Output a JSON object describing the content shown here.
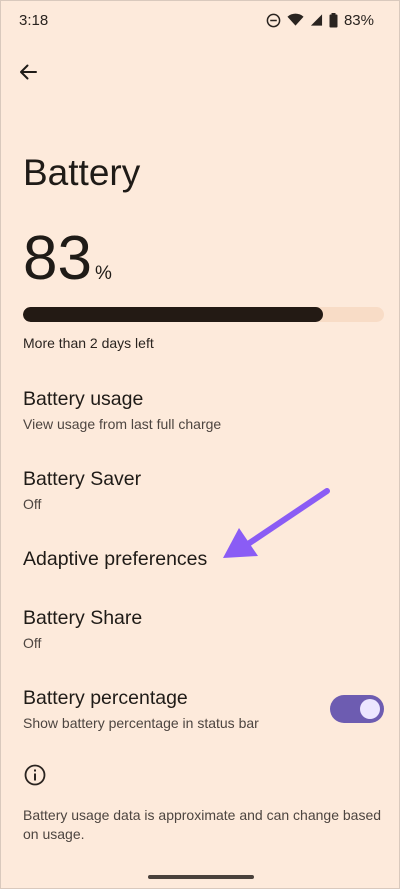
{
  "status_bar": {
    "time": "3:18",
    "battery_pct": "83%",
    "icons": [
      "do-not-disturb-icon",
      "wifi-icon",
      "signal-icon",
      "battery-icon"
    ]
  },
  "header": {
    "back_icon": "arrow-left-icon",
    "title": "Battery"
  },
  "battery": {
    "level_value": "83",
    "level_unit": "%",
    "level_fraction": 0.83,
    "time_left": "More than 2 days left"
  },
  "settings": {
    "usage": {
      "title": "Battery usage",
      "subtitle": "View usage from last full charge"
    },
    "saver": {
      "title": "Battery Saver",
      "subtitle": "Off"
    },
    "adaptive": {
      "title": "Adaptive preferences"
    },
    "share": {
      "title": "Battery Share",
      "subtitle": "Off"
    },
    "percentage": {
      "title": "Battery percentage",
      "subtitle": "Show battery percentage in status bar",
      "enabled": true
    }
  },
  "footer": {
    "info_icon": "info-icon",
    "note": "Battery usage data is approximate and can change based on usage."
  },
  "colors": {
    "background": "#fdeadb",
    "bar_fill": "#231a14",
    "bar_track": "#f8dcc6",
    "toggle_on": "#6d5cb1",
    "annotation_arrow": "#8a5cf5"
  }
}
